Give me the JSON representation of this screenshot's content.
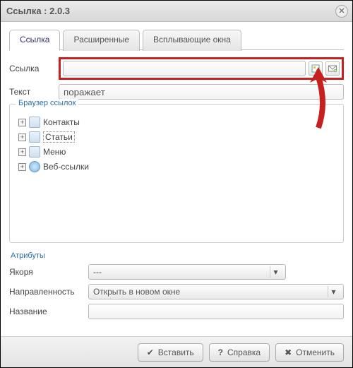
{
  "dialog": {
    "title": "Ссылка : 2.0.3"
  },
  "tabs": {
    "link": "Ссылка",
    "advanced": "Расширенные",
    "popups": "Всплывающие окна"
  },
  "link": {
    "label": "Ссылка",
    "value": ""
  },
  "text": {
    "label": "Текст",
    "value": "поражает"
  },
  "browser": {
    "legend": "Браузер ссылок",
    "items": [
      {
        "label": "Контакты",
        "icon": "doc",
        "selected": false
      },
      {
        "label": "Статьи",
        "icon": "doc",
        "selected": true
      },
      {
        "label": "Меню",
        "icon": "doc",
        "selected": false
      },
      {
        "label": "Веб-ссылки",
        "icon": "globe",
        "selected": false
      }
    ]
  },
  "attributes": {
    "title": "Атрибуты",
    "anchors": {
      "label": "Якоря",
      "value": "---"
    },
    "target": {
      "label": "Направленность",
      "value": "Открыть в новом окне"
    },
    "name": {
      "label": "Название",
      "value": ""
    }
  },
  "buttons": {
    "insert": "Вставить",
    "help": "Справка",
    "cancel": "Отменить"
  }
}
